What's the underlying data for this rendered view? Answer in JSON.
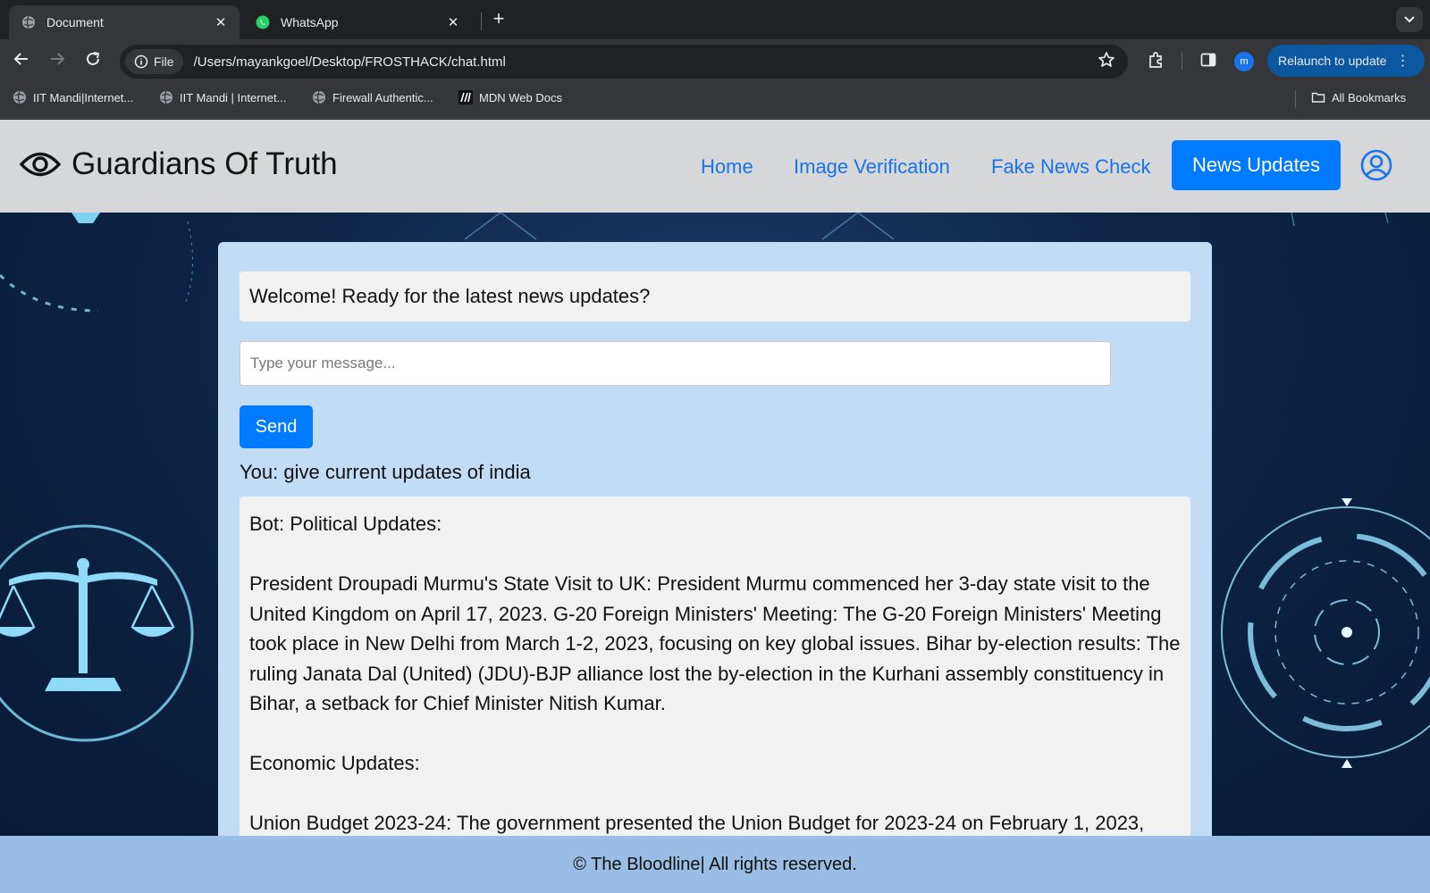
{
  "browser": {
    "tabs": [
      {
        "title": "Document",
        "active": true,
        "icon": "globe-icon"
      },
      {
        "title": "WhatsApp",
        "active": false,
        "icon": "whatsapp-icon"
      }
    ],
    "address": {
      "scheme_chip": "File",
      "url": "/Users/mayankgoel/Desktop/FROSTHACK/chat.html"
    },
    "profile_initial": "m",
    "relaunch_label": "Relaunch to update",
    "bookmarks": [
      {
        "label": "IIT Mandi|Internet..."
      },
      {
        "label": "IIT Mandi | Internet..."
      },
      {
        "label": "Firewall Authentic..."
      },
      {
        "label": "MDN Web Docs"
      }
    ],
    "all_bookmarks_label": "All Bookmarks"
  },
  "site": {
    "brand": "Guardians Of Truth",
    "nav": [
      {
        "label": "Home"
      },
      {
        "label": "Image Verification"
      },
      {
        "label": "Fake News Check"
      },
      {
        "label": "News Updates",
        "active": true
      }
    ],
    "accent_color": "#007bff"
  },
  "chat": {
    "welcome": "Welcome! Ready for the latest news updates?",
    "input_placeholder": "Type your message...",
    "send_label": "Send",
    "user_message": "You: give current updates of india",
    "bot_heading": "Bot: Political Updates:",
    "bot_political": "President Droupadi Murmu's State Visit to UK: President Murmu commenced her 3-day state visit to the United Kingdom on April 17, 2023. G-20 Foreign Ministers' Meeting: The G-20 Foreign Ministers' Meeting took place in New Delhi from March 1-2, 2023, focusing on key global issues. Bihar by-election results: The ruling Janata Dal (United) (JDU)-BJP alliance lost the by-election in the Kurhani assembly constituency in Bihar, a setback for Chief Minister Nitish Kumar.",
    "bot_economic_heading": "Economic Updates:",
    "bot_economic": "Union Budget 2023-24: The government presented the Union Budget for 2023-24 on February 1, 2023,"
  },
  "footer": {
    "text": "© The Bloodline| All rights reserved."
  }
}
